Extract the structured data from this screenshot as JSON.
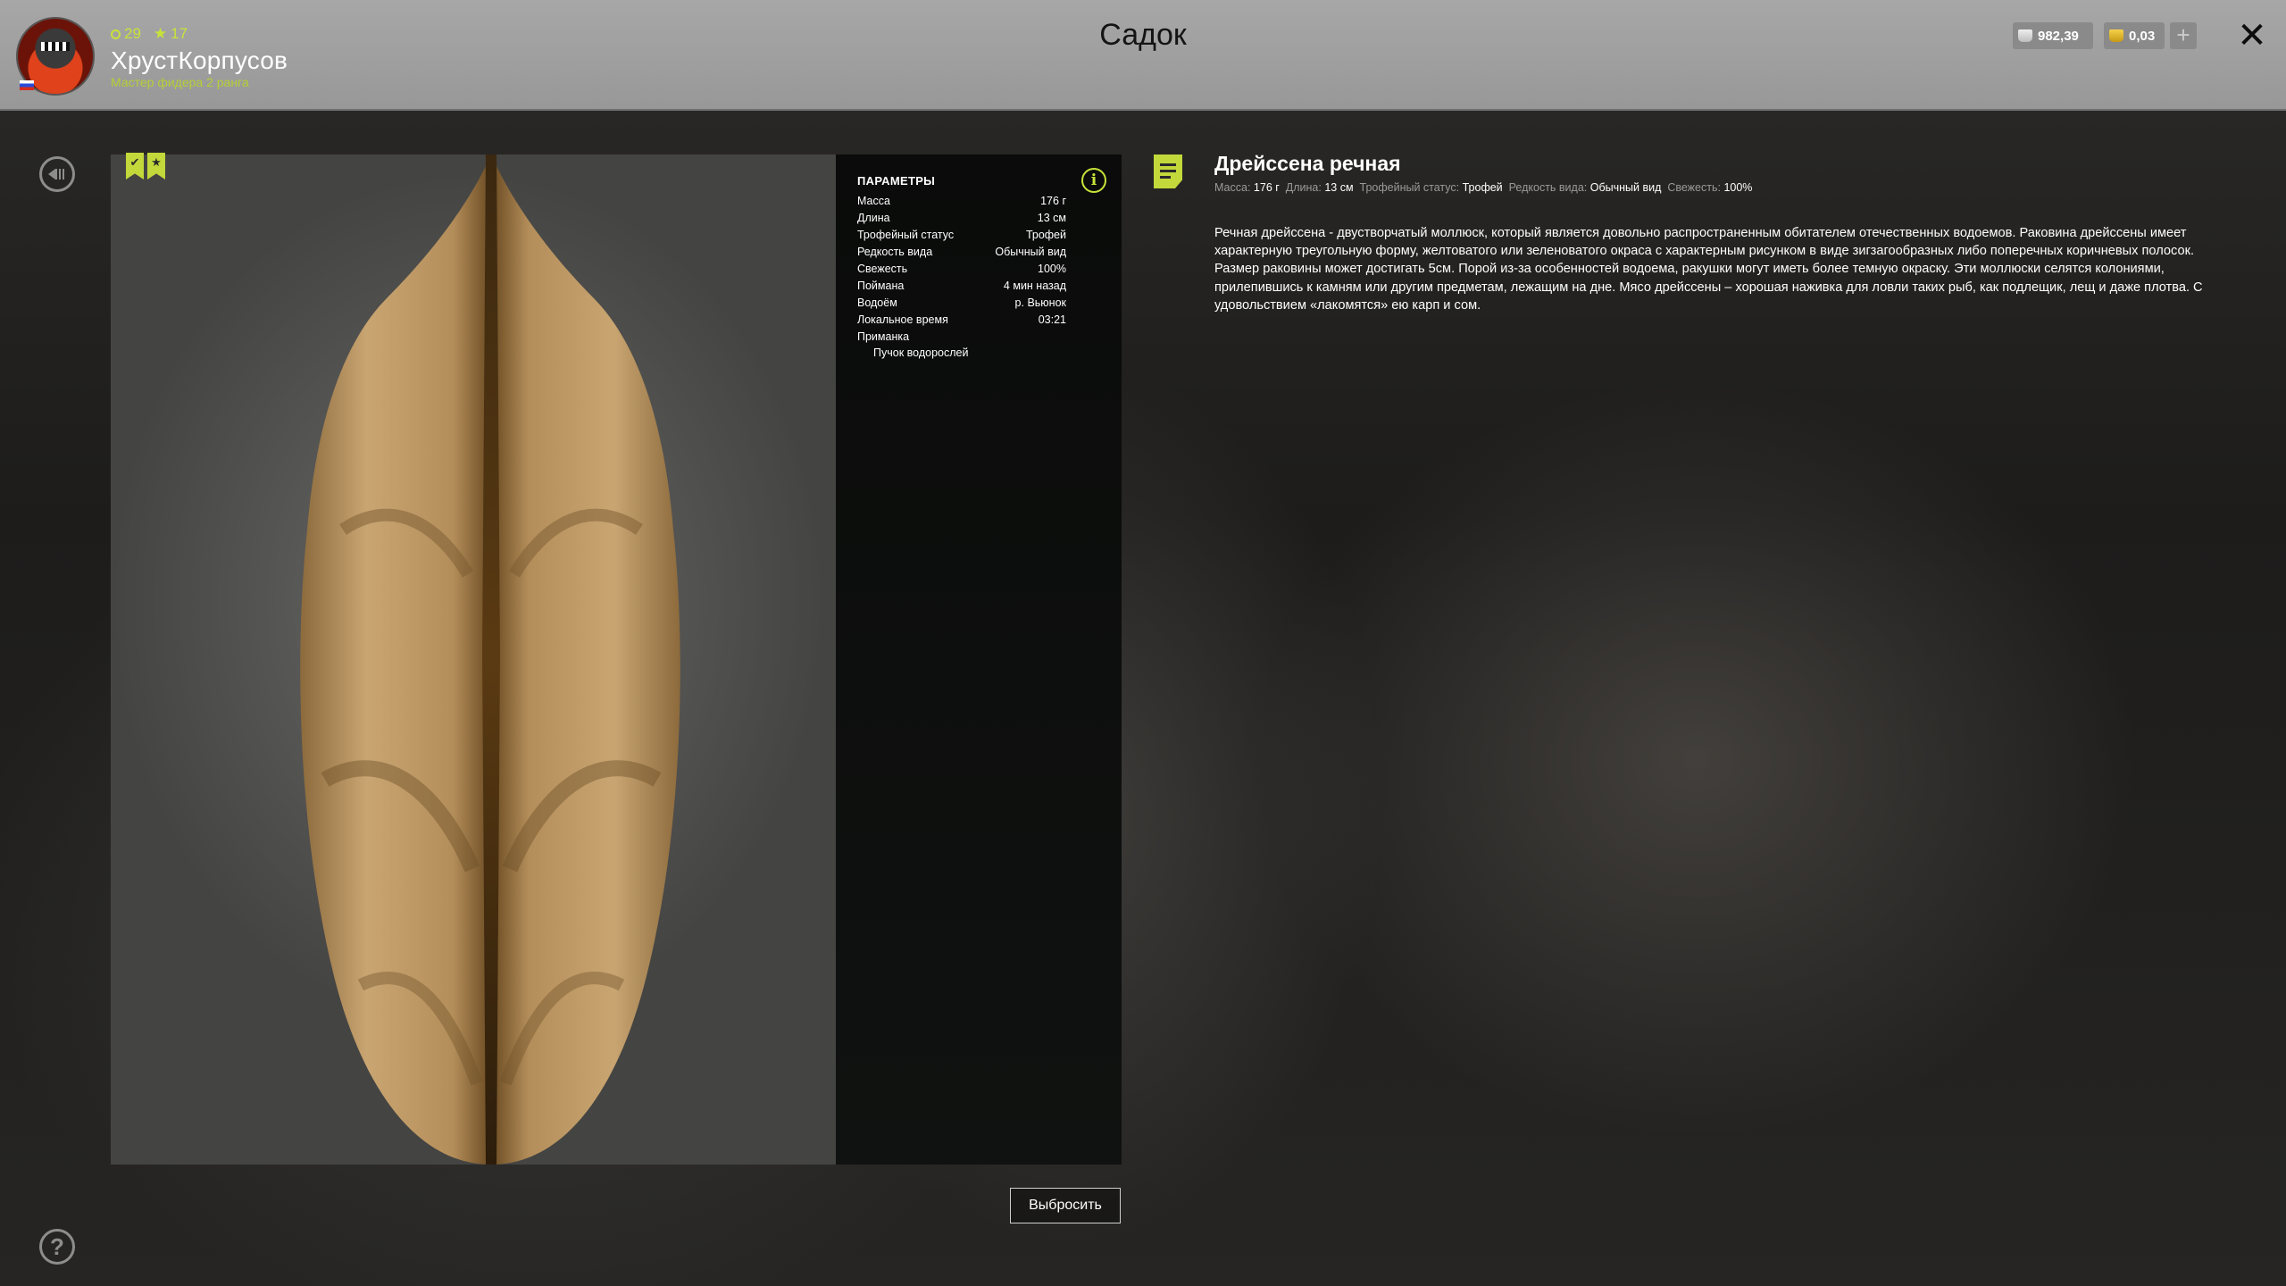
{
  "player": {
    "level": "29",
    "stars": "17",
    "name": "ХрустКорпусов",
    "rank": "Мастер фидера 2 ранга"
  },
  "header": {
    "title": "Садок",
    "silver": "982,39",
    "gold": "0,03",
    "plus": "+",
    "close": "✕"
  },
  "badges": {
    "trophy": "✔",
    "star": "★"
  },
  "params": {
    "title": "ПАРАМЕТРЫ",
    "rows": [
      {
        "label": "Масса",
        "value": "176 г"
      },
      {
        "label": "Длина",
        "value": "13 см"
      },
      {
        "label": "Трофейный статус",
        "value": "Трофей"
      },
      {
        "label": "Редкость вида",
        "value": "Обычный вид"
      },
      {
        "label": "Свежесть",
        "value": "100%"
      },
      {
        "label": "Поймана",
        "value": "4 мин назад"
      },
      {
        "label": "Водоём",
        "value": "р. Вьюнок"
      },
      {
        "label": "Локальное время",
        "value": "03:21"
      }
    ],
    "bait_label": "Приманка",
    "bait_value": "Пучок водорослей"
  },
  "actions": {
    "discard": "Выбросить",
    "help": "?"
  },
  "species": {
    "name": "Дрейссена речная",
    "meta": {
      "mass_label": "Масса:",
      "mass": "176 г",
      "length_label": "Длина:",
      "length": "13 см",
      "trophy_label": "Трофейный статус:",
      "trophy": "Трофей",
      "rarity_label": "Редкость вида:",
      "rarity": "Обычный вид",
      "fresh_label": "Свежесть:",
      "fresh": "100%"
    },
    "description": "Речная дрейссена - двустворчатый моллюск, который является довольно распространенным обитателем отечественных водоемов. Раковина дрейссены имеет характерную треугольную форму, желтоватого или зеленоватого окраса с характерным рисунком в виде зигзагообразных либо поперечных коричневых полосок. Размер раковины может достигать 5см. Порой из-за особенностей водоема, ракушки могут иметь более темную окраску. Эти моллюски селятся колониями, прилепившись к камням или другим предметам, лежащим на дне. Мясо дрейссены – хорошая наживка для ловли таких рыб, как подлещик, лещ и даже плотва. С удовольствием «лакомятся» ею карп и сом."
  },
  "colors": {
    "accent": "#c9e23a",
    "topbar": "#a0a0a0",
    "panel": "#0d0e0d"
  }
}
